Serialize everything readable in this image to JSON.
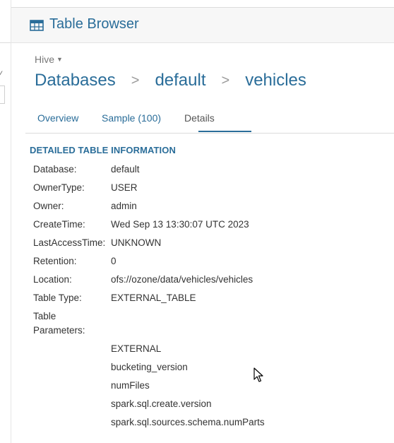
{
  "header": {
    "title": "Table Browser",
    "icon": "table-icon"
  },
  "source": {
    "label": "Hive"
  },
  "breadcrumb": {
    "items": [
      "Databases",
      "default",
      "vehicles"
    ],
    "separator": ">"
  },
  "tabs": [
    {
      "label": "Overview",
      "active": false
    },
    {
      "label": "Sample (100)",
      "active": false
    },
    {
      "label": "Details",
      "active": true
    }
  ],
  "details": {
    "section_title": "DETAILED TABLE INFORMATION",
    "rows": [
      {
        "key": "Database:",
        "value": "default"
      },
      {
        "key": "OwnerType:",
        "value": "USER"
      },
      {
        "key": "Owner:",
        "value": "admin"
      },
      {
        "key": "CreateTime:",
        "value": "Wed Sep 13 13:30:07 UTC 2023"
      },
      {
        "key": "LastAccessTime:",
        "value": "UNKNOWN"
      },
      {
        "key": "Retention:",
        "value": "0"
      },
      {
        "key": "Location:",
        "value": "ofs://ozone/data/vehicles/vehicles"
      },
      {
        "key": "Table Type:",
        "value": "EXTERNAL_TABLE"
      }
    ],
    "params_key_line1": "Table",
    "params_key_line2": "Parameters:",
    "parameters": [
      "EXTERNAL",
      "bucketing_version",
      "numFiles",
      "spark.sql.create.version",
      "spark.sql.sources.schema.numParts"
    ]
  },
  "colors": {
    "accent": "#2a6d99",
    "muted": "#777777",
    "header_bg": "#f7f7f7"
  }
}
